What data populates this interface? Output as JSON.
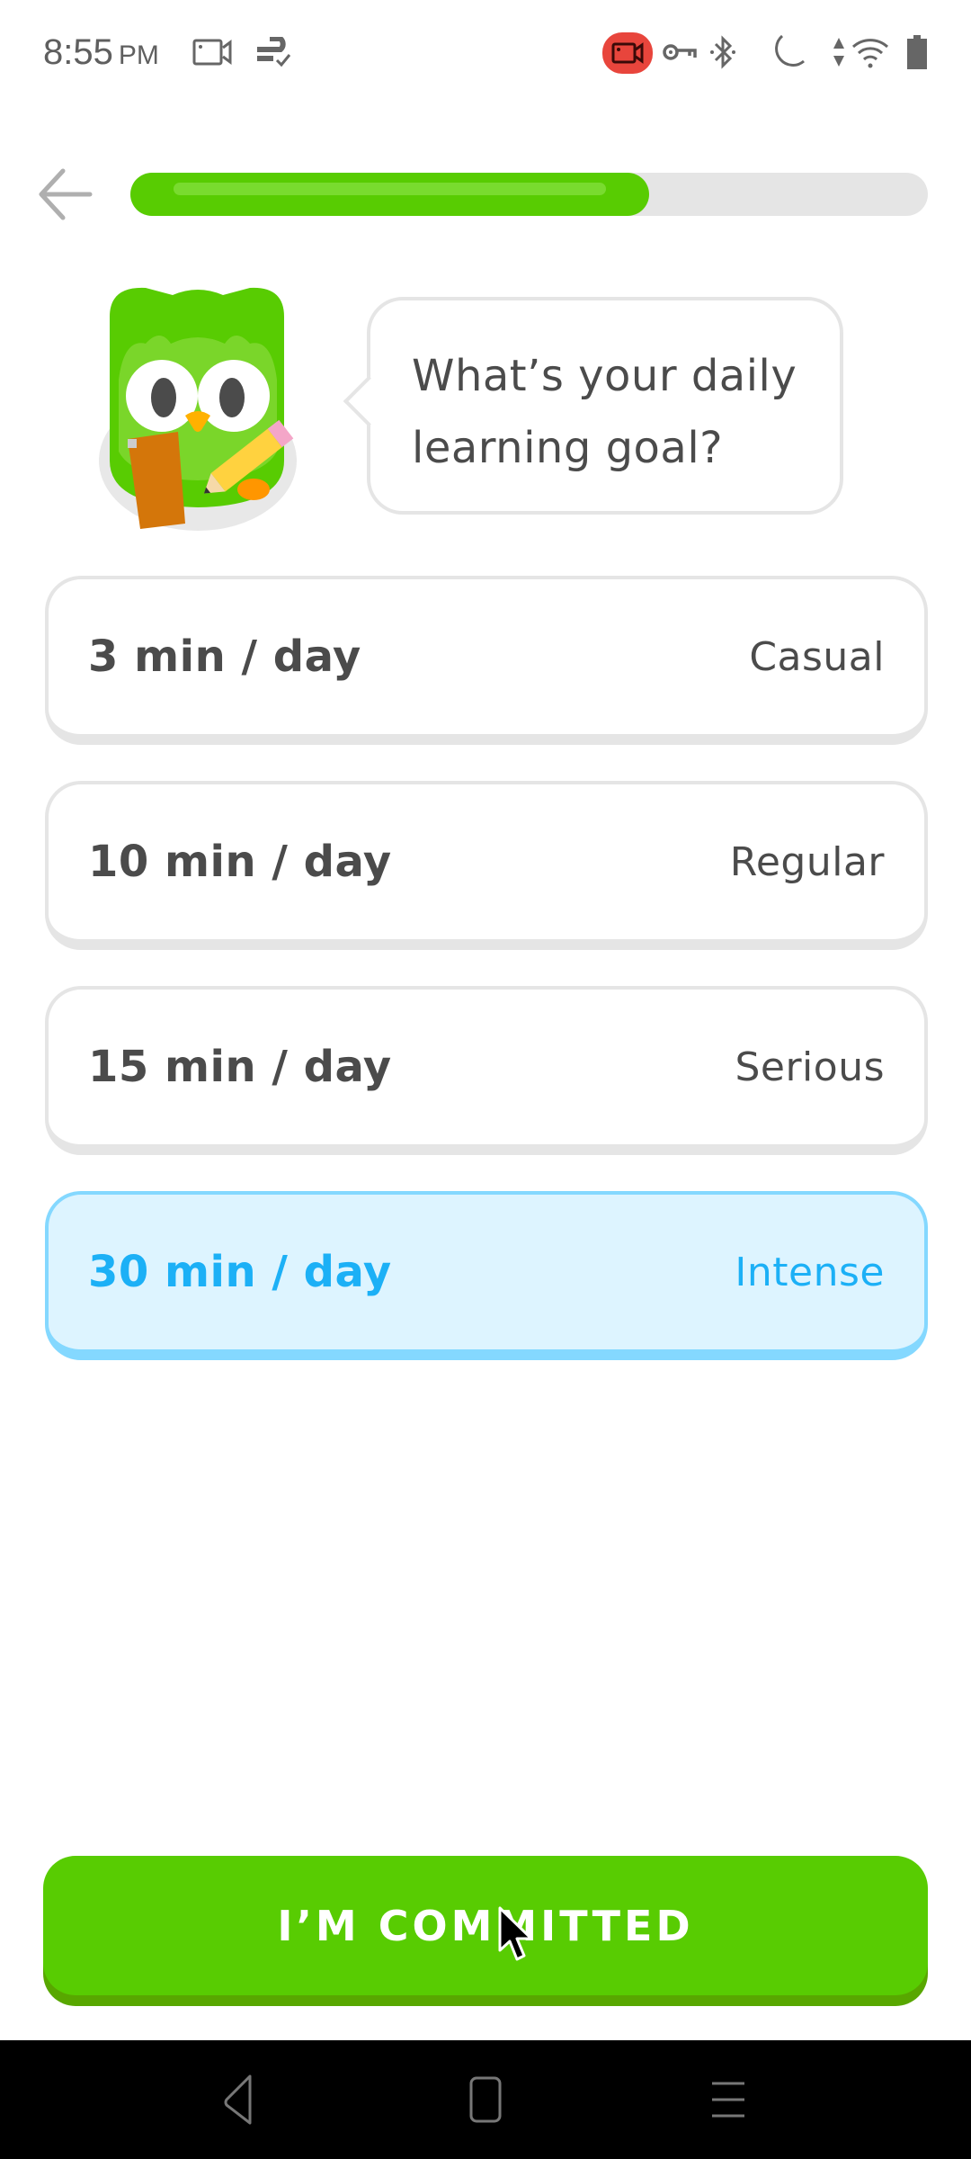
{
  "status_bar": {
    "time": "8:55",
    "ampm": "PM",
    "left_icons": [
      "screen-record-icon",
      "data-saver-icon"
    ],
    "right_icons": [
      "recording-indicator-icon",
      "vpn-key-icon",
      "bluetooth-icon",
      "do-not-disturb-moon-icon",
      "data-arrows-icon",
      "wifi-icon",
      "battery-icon"
    ],
    "recording_color": "#e8453c"
  },
  "header": {
    "back_icon": "arrow-left-icon",
    "progress_percent": 65
  },
  "prompt": {
    "mascot": "duo-owl-with-clipboard-and-pencil",
    "question": "What’s your daily learning goal?"
  },
  "options": [
    {
      "time": "3 min / day",
      "level": "Casual",
      "selected": false
    },
    {
      "time": "10 min / day",
      "level": "Regular",
      "selected": false
    },
    {
      "time": "15 min / day",
      "level": "Serious",
      "selected": false
    },
    {
      "time": "30 min / day",
      "level": "Intense",
      "selected": true
    }
  ],
  "cta": {
    "label": "I’M COMMITTED"
  },
  "nav_bar": {
    "back_icon": "nav-back-icon",
    "home_icon": "nav-home-icon",
    "recents_icon": "nav-menu-icon"
  },
  "colors": {
    "brand_green": "#58cc02",
    "selected_blue": "#1cb0f6",
    "selected_bg": "#ddf4ff",
    "selected_border": "#84d8ff",
    "border_gray": "#e5e5e5"
  }
}
